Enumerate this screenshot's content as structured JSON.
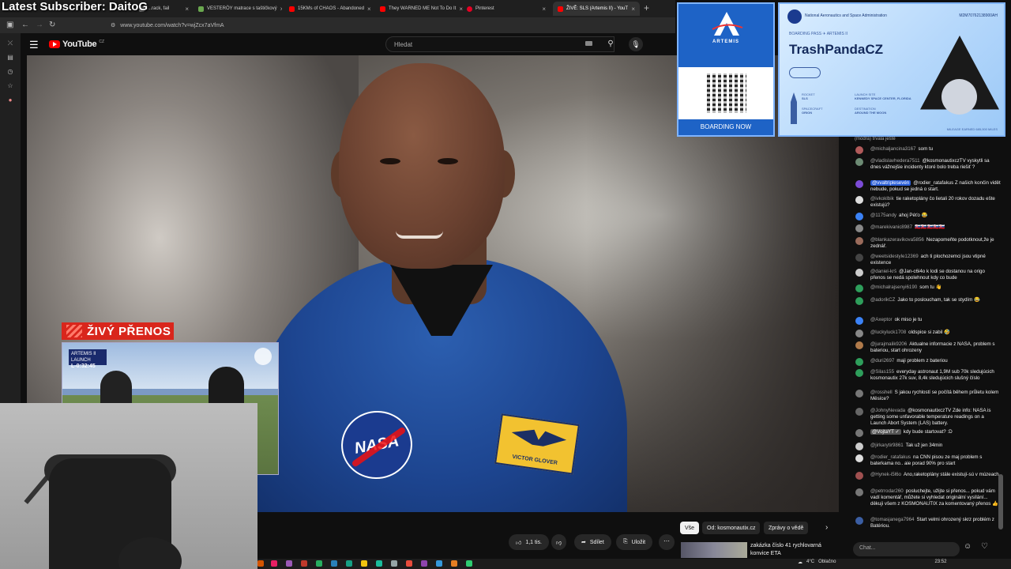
{
  "stream_title": "Latest Subscriber: DaitoG",
  "browser": {
    "tabs": [
      {
        "label": "...rack, fail",
        "color": "#7a7a7a",
        "active": false
      },
      {
        "label": "VESTERÖY matrace s taštičkový",
        "color": "#6aa84f",
        "active": false
      },
      {
        "label": "15KMs of CHAOS - Abandoned",
        "color": "#ff0000",
        "active": false
      },
      {
        "label": "They WARNED ME Not To Do It",
        "color": "#ff0000",
        "active": false
      },
      {
        "label": "Pinterest",
        "color": "#e60023",
        "active": false
      },
      {
        "label": "ŽIVĚ: SLS (Artemis II) - YouT",
        "color": "#ff0000",
        "active": true
      }
    ],
    "new_tab": "+",
    "url": "www.youtube.com/watch?v=wjZcx7aVfmA"
  },
  "youtube": {
    "logo_text": "YouTube",
    "country": "CZ",
    "search_placeholder": "Hledat"
  },
  "video": {
    "live_label": "ŽIVÝ PŘENOS",
    "pip_timer_label": "ARTEMIS II LAUNCH",
    "pip_timer": "L-0:32:45",
    "name_tag": "VICTOR GLOVER",
    "nasa_text": "NASA"
  },
  "actions": {
    "likes": "1,1 tis.",
    "share": "Sdílet",
    "save": "Uložit"
  },
  "chips": {
    "all": "Vše",
    "from": "Od: kosmonautix.cz",
    "news": "Zprávy o vědě"
  },
  "recommendation": {
    "title": "zakázka číslo 41 rychlovarná konvice ETA"
  },
  "boarding_pass": {
    "artemis": "ARTEMIS",
    "boarding_now": "BOARDING NOW",
    "agency": "National Aeronautics and Space Administration",
    "code": "M2M70762138900AH",
    "pass_label": "BOARDING PASS ✈ ARTEMIS II",
    "name": "TrashPandaCZ",
    "rocket_label": "ROCKET",
    "rocket_value": "SLS",
    "launch_label": "LAUNCH SITE",
    "launch_value": "KENNEDY SPACE CENTER, FLORIDA",
    "spacecraft_label": "SPACECRAFT",
    "spacecraft_value": "ORION",
    "destination_label": "DESTINATION",
    "destination_value": "AROUND THE MOON",
    "footer": "MILEAGE EARNED 685,000 MILES"
  },
  "chat": {
    "top_fragment": "(modrá) trvala ještě",
    "messages": [
      {
        "author": "@michaljancina3167",
        "text": "som tu",
        "color": "#b05a5a"
      },
      {
        "author": "@vladislavhedera7511",
        "text": "@kosmonautixczTV vyskytli sa dnes vážnejšie incidenty ktoré bolo treba riešiť ?",
        "color": "#6d8b74"
      },
      {
        "author": "@vvaltriplesevén",
        "text": "@rodier_ratafakus Z našich končin vidět nebude, pokud se jedná o start.",
        "color": "#7b4bd6",
        "hi": true
      },
      {
        "author": "@ivkoklbik",
        "text": "tie raketoplány čo lietali 20 rokov dozadu ešte existujú?",
        "color": "#ddd"
      },
      {
        "author": "@1175andy",
        "text": "ahoj Péťo 😂",
        "color": "#3b82f6"
      },
      {
        "author": "@marekivanic8987",
        "text": "🇸🇰🇸🇰🇸🇰🇸🇰🇸🇰",
        "color": "#888"
      },
      {
        "author": "@blankazeravikova5856",
        "text": "Nezapomeňte podotknout,že je zednář.",
        "color": "#9a6b5b"
      },
      {
        "author": "@weetsidestyle12369",
        "text": "ach ti plochozemci jsou vtipné existence",
        "color": "#444"
      },
      {
        "author": "@daniel-krš",
        "text": "@Jan-c6i4o k lodi se dostanou na origo přenos se nedá spolehnout kdy co bude",
        "color": "#ccc"
      },
      {
        "author": "@michalrajsenyi6190",
        "text": "som tu 👋",
        "color": "#2e9e5b"
      },
      {
        "author": "@adorikCZ",
        "text": "Jako to posloucham, tak se stydím 😂",
        "color": "#2e9e5b"
      },
      {
        "author": "@Axeptor",
        "text": "ok miso je tu",
        "color": "#3b82f6"
      },
      {
        "author": "@luckyluck1708",
        "text": "oldspice si zabil 🤣",
        "color": "#888"
      },
      {
        "author": "@jurajmalik9206",
        "text": "Aktualne informacie z NASA, problem s bateriou, start ohrozeny",
        "color": "#b07a4a"
      },
      {
        "author": "@duri2697",
        "text": "maji problem z bateriou",
        "color": "#2e9e5b"
      },
      {
        "author": "@Silas155",
        "text": "everyday astronaut 1,9M sub 70k sledujúcich kosmonautix 27k suv, 8,4k sledujúcich slušný číslo",
        "color": "#2e9e5b"
      },
      {
        "author": "@rosshell",
        "text": "S jakou rychlostí se počítá během průletu kolem Měsíce?",
        "color": "#777"
      },
      {
        "author": "@JohnyNevada",
        "text": "@kosmonautixczTV Zde info: NASA is getting some unfavorable temperature readings on a Launch Abort System (LAS) battery.",
        "color": "#666"
      },
      {
        "author": "@VojtaYT ✓",
        "text": "kdy bude startovat? :D",
        "color": "#777",
        "mod": true
      },
      {
        "author": "@jirkarytir9861",
        "text": "Tak už jen 34min",
        "color": "#ccc"
      },
      {
        "author": "@rodier_ratafakus",
        "text": "na CNN pisou ze maj problem s baterkama no.. aie porad 90% pro start",
        "color": "#ddd"
      },
      {
        "author": "@Hynek-i5l6o",
        "text": "Ano,raketoplány stále existují-sú v múzeach",
        "color": "#a05050"
      },
      {
        "author": "@petrrodar260",
        "text": "posluchejte, užijte si přenos... pokud vám vadí komentář, můžete si vyhledat originální vysílání... děkuji všem z KOSMONAUTIX za komentovaný přenos 👍",
        "color": "#777"
      },
      {
        "author": "@tomasjanega7964",
        "text": "Start velmi ohrozený skrz problém z Batériou.",
        "color": "#3b5ea3"
      }
    ],
    "input_placeholder": "Chat..."
  },
  "taskbar": {
    "weather": "4°C",
    "weather_text": "Oblačno",
    "time": "23:52"
  }
}
